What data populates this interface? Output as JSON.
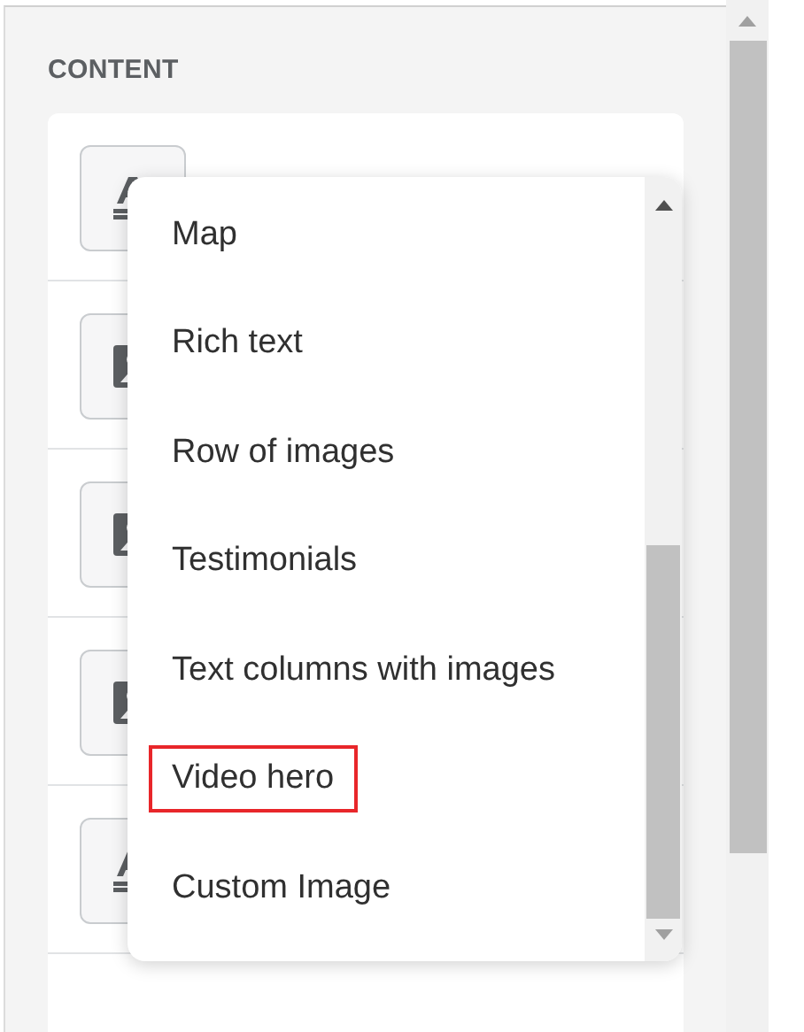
{
  "section": {
    "title": "CONTENT"
  },
  "blocks": [
    {
      "kind": "text"
    },
    {
      "kind": "image"
    },
    {
      "kind": "image"
    },
    {
      "kind": "image"
    },
    {
      "kind": "text"
    }
  ],
  "dropdown": {
    "items": [
      {
        "label": "Map",
        "highlighted": false
      },
      {
        "label": "Rich text",
        "highlighted": false
      },
      {
        "label": "Row of images",
        "highlighted": false
      },
      {
        "label": "Testimonials",
        "highlighted": false
      },
      {
        "label": "Text columns with images",
        "highlighted": false
      },
      {
        "label": "Video hero",
        "highlighted": true
      },
      {
        "label": "Custom Image",
        "highlighted": false
      }
    ]
  }
}
